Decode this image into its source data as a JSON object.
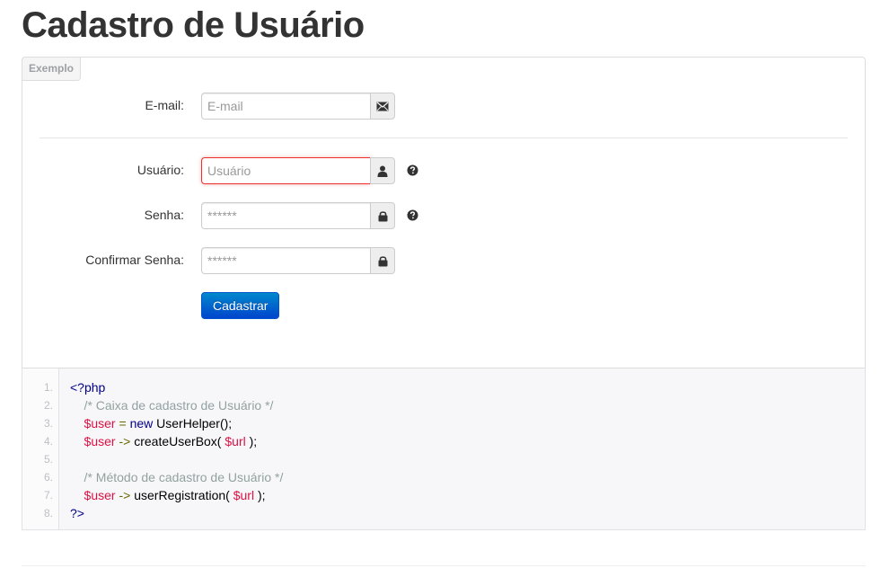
{
  "page": {
    "title": "Cadastro de Usuário"
  },
  "example": {
    "tag": "Exemplo"
  },
  "form": {
    "email": {
      "label": "E-mail:",
      "placeholder": "E-mail",
      "value": "",
      "icon": "envelope-icon"
    },
    "username": {
      "label": "Usuário:",
      "placeholder": "Usuário",
      "value": "",
      "icon": "user-icon",
      "help_icon": "question-circle-icon"
    },
    "password": {
      "label": "Senha:",
      "placeholder": "******",
      "value": "",
      "icon": "lock-icon",
      "help_icon": "question-circle-icon"
    },
    "confirm_password": {
      "label": "Confirmar Senha:",
      "placeholder": "******",
      "value": "",
      "icon": "lock-icon"
    },
    "submit_label": "Cadastrar"
  },
  "code": {
    "line_numbers": [
      "1.",
      "2.",
      "3.",
      "4.",
      "5.",
      "6.",
      "7.",
      "8."
    ],
    "lines": [
      [
        {
          "t": "kw",
          "s": "<?php"
        }
      ],
      [
        {
          "t": "com",
          "s": "    /* Caixa de cadastro de Usuário */"
        }
      ],
      [
        {
          "t": "var",
          "s": "    $user"
        },
        {
          "t": "pun",
          "s": " = "
        },
        {
          "t": "kw",
          "s": "new"
        },
        {
          "t": "pln",
          "s": " UserHelper();"
        }
      ],
      [
        {
          "t": "var",
          "s": "    $user"
        },
        {
          "t": "pun",
          "s": " -> "
        },
        {
          "t": "pln",
          "s": "createUserBox( "
        },
        {
          "t": "var",
          "s": "$url"
        },
        {
          "t": "pln",
          "s": " );"
        }
      ],
      [],
      [
        {
          "t": "com",
          "s": "    /* Método de cadastro de Usuário */"
        }
      ],
      [
        {
          "t": "var",
          "s": "    $user"
        },
        {
          "t": "pun",
          "s": " -> "
        },
        {
          "t": "pln",
          "s": "userRegistration( "
        },
        {
          "t": "var",
          "s": "$url"
        },
        {
          "t": "pln",
          "s": " );"
        }
      ],
      [
        {
          "t": "kw",
          "s": "?>"
        }
      ]
    ]
  },
  "colors": {
    "primary": "#0074cc",
    "error": "#e9322d",
    "code_bg": "#f7f7f9"
  }
}
